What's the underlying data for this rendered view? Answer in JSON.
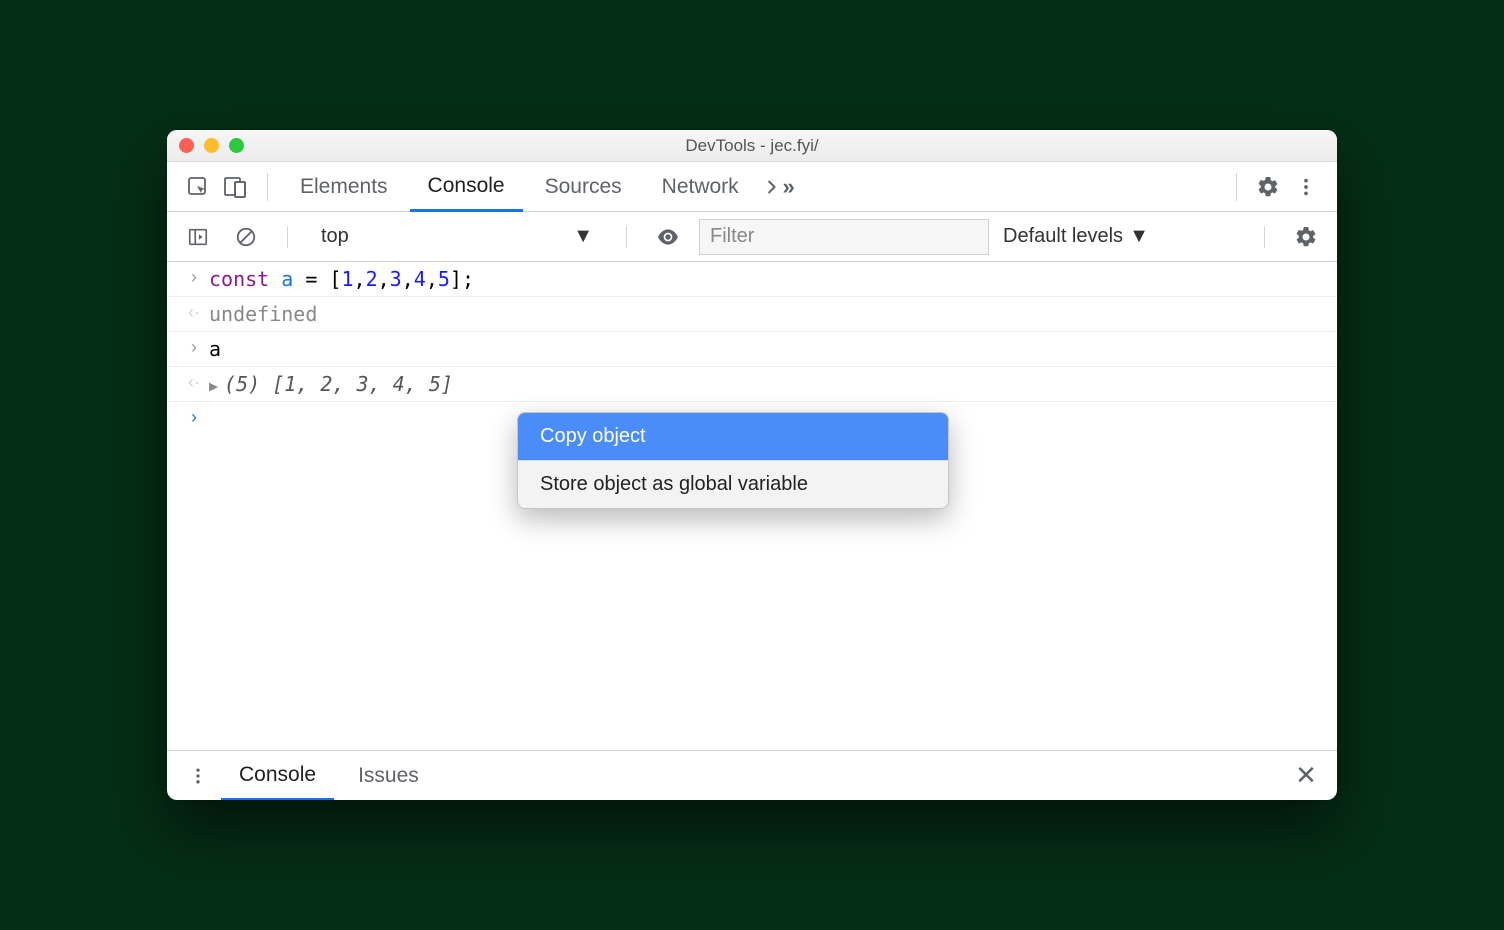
{
  "window": {
    "title": "DevTools - jec.fyi/"
  },
  "tabs": {
    "elements": "Elements",
    "console": "Console",
    "sources": "Sources",
    "network": "Network"
  },
  "toolbar": {
    "context": "top",
    "filter_placeholder": "Filter",
    "levels": "Default levels"
  },
  "console": {
    "line1_kw": "const",
    "line1_var": " a ",
    "line1_eq": "=",
    "line1_vals": [
      "1",
      "2",
      "3",
      "4",
      "5"
    ],
    "line2_result": "undefined",
    "line3_input": "a",
    "line4_count": "(5)",
    "line4_vals": [
      "1",
      "2",
      "3",
      "4",
      "5"
    ]
  },
  "context_menu": {
    "copy_object": "Copy object",
    "store_global": "Store object as global variable"
  },
  "drawer": {
    "console": "Console",
    "issues": "Issues"
  }
}
